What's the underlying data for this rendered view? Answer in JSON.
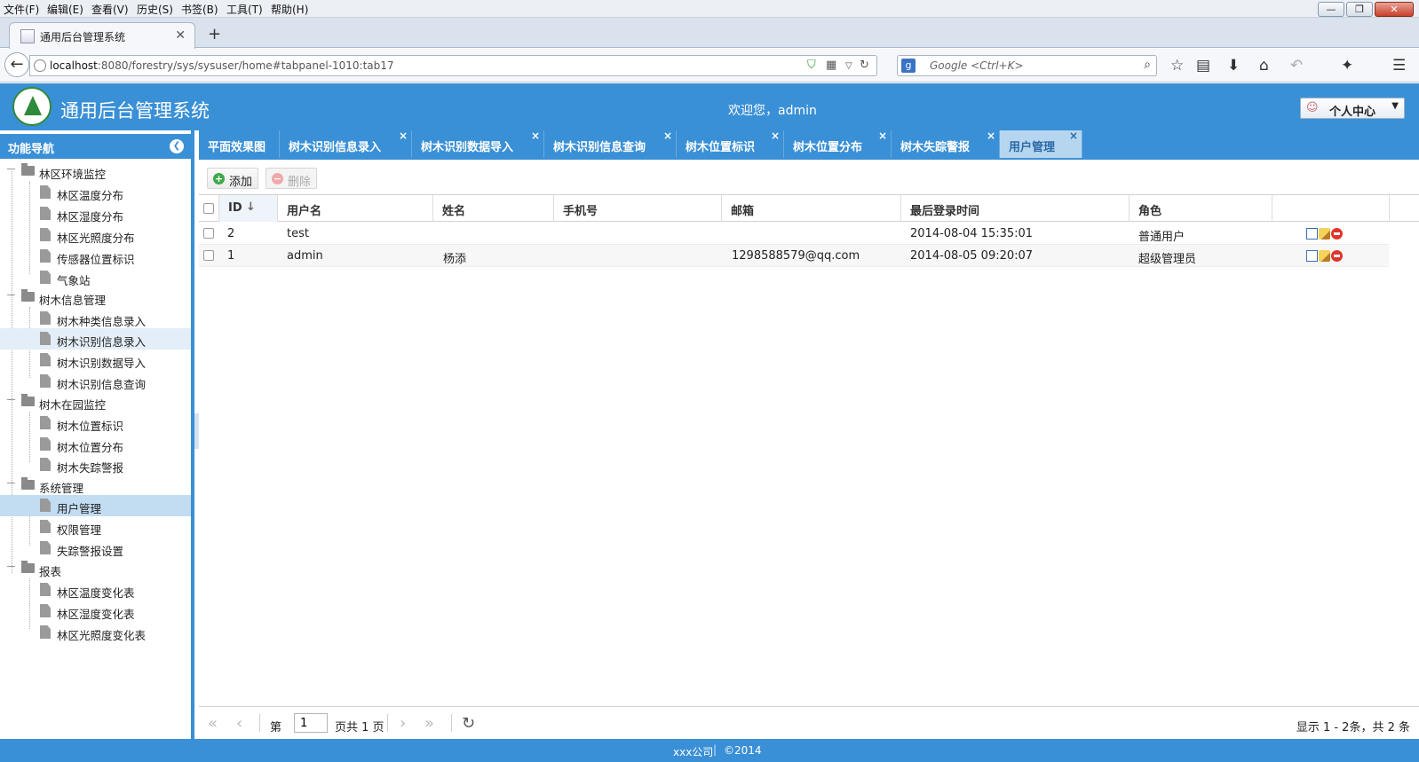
{
  "browser": {
    "menus": [
      "文件(F)",
      "编辑(E)",
      "查看(V)",
      "历史(S)",
      "书签(B)",
      "工具(T)",
      "帮助(H)"
    ],
    "tab_title": "通用后台管理系统",
    "url_host": "localhost",
    "url_rest": ":8080/forestry/sys/sysuser/home#tabpanel-1010:tab17",
    "search_placeholder": "Google <Ctrl+K>"
  },
  "header": {
    "title": "通用后台管理系统",
    "welcome": "欢迎您，admin",
    "personal_center": "个人中心"
  },
  "sidebar": {
    "title": "功能导航",
    "groups": [
      {
        "label": "林区环境监控",
        "items": [
          "林区温度分布",
          "林区湿度分布",
          "林区光照度分布",
          "传感器位置标识",
          "气象站"
        ]
      },
      {
        "label": "树木信息管理",
        "items": [
          "树木种类信息录入",
          "树木识别信息录入",
          "树木识别数据导入",
          "树木识别信息查询"
        ]
      },
      {
        "label": "树木在园监控",
        "items": [
          "树木位置标识",
          "树木位置分布",
          "树木失踪警报"
        ]
      },
      {
        "label": "系统管理",
        "items": [
          "用户管理",
          "权限管理",
          "失踪警报设置"
        ]
      },
      {
        "label": "报表",
        "items": [
          "林区温度变化表",
          "林区湿度变化表",
          "林区光照度变化表"
        ]
      }
    ]
  },
  "tabs": [
    "平面效果图",
    "树木识别信息录入",
    "树木识别数据导入",
    "树木识别信息查询",
    "树木位置标识",
    "树木位置分布",
    "树木失踪警报",
    "用户管理"
  ],
  "toolbar": {
    "add": "添加",
    "delete": "删除"
  },
  "grid": {
    "columns": [
      "ID",
      "用户名",
      "姓名",
      "手机号",
      "邮箱",
      "最后登录时间",
      "角色"
    ],
    "rows": [
      {
        "id": "2",
        "username": "test",
        "name": "",
        "phone": "",
        "email": "",
        "last_login": "2014-08-04 15:35:01",
        "role": "普通用户"
      },
      {
        "id": "1",
        "username": "admin",
        "name": "杨添",
        "phone": "",
        "email": "1298588579@qq.com",
        "last_login": "2014-08-05 09:20:07",
        "role": "超级管理员"
      }
    ]
  },
  "pager": {
    "page_prefix": "第",
    "page_value": "1",
    "page_suffix": "页共 1 页",
    "summary": "显示 1 - 2条，共 2 条"
  },
  "footer": {
    "company": "xxx公司",
    "copyright": "©2014"
  }
}
